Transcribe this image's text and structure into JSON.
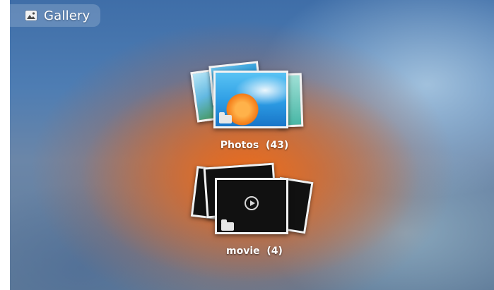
{
  "action_bar": {
    "title": "Gallery",
    "icon": "gallery-icon"
  },
  "albums": [
    {
      "name": "Photos",
      "count": "(43)",
      "label": "Photos  (43)",
      "type": "photos"
    },
    {
      "name": "movie",
      "count": "(4)",
      "label": "movie  (4)",
      "type": "video"
    }
  ],
  "colors": {
    "background_top": "#3f6ea8",
    "background_center": "#eb6e1e",
    "label_text": "#ffffff",
    "card_border": "#f3f3f3",
    "video_card": "#111111"
  }
}
